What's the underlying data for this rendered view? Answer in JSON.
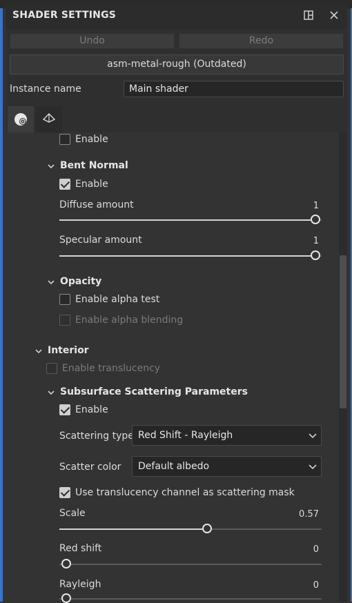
{
  "panel": {
    "title": "SHADER SETTINGS"
  },
  "toolbar": {
    "undo_label": "Undo",
    "redo_label": "Redo"
  },
  "shader": {
    "preset_label": "asm-metal-rough (Outdated)"
  },
  "instance": {
    "label": "Instance name",
    "value": "Main shader"
  },
  "tabs": [
    {
      "icon": "material-sphere-icon"
    },
    {
      "icon": "geometry-icon"
    }
  ],
  "sections": {
    "top_enable": {
      "label": "Enable",
      "checked": false
    },
    "bent_normal": {
      "title": "Bent Normal",
      "enable_label": "Enable",
      "diffuse": {
        "label": "Diffuse amount",
        "value": "1",
        "fraction": 1.0
      },
      "specular": {
        "label": "Specular amount",
        "value": "1",
        "fraction": 1.0
      }
    },
    "opacity": {
      "title": "Opacity",
      "alpha_test_label": "Enable alpha test",
      "alpha_blending_label": "Enable alpha blending"
    },
    "interior": {
      "title": "Interior",
      "translucency_label": "Enable translucency"
    },
    "sss": {
      "title": "Subsurface Scattering Parameters",
      "enable_label": "Enable",
      "scattering_type": {
        "label": "Scattering type",
        "value": "Red Shift - Rayleigh"
      },
      "scatter_color": {
        "label": "Scatter color",
        "value": "Default albedo"
      },
      "mask_label": "Use translucency channel as scattering mask",
      "scale": {
        "label": "Scale",
        "value": "0.57",
        "fraction": 0.57
      },
      "red_shift": {
        "label": "Red shift",
        "value": "0",
        "fraction": 0.0
      },
      "rayleigh": {
        "label": "Rayleigh",
        "value": "0",
        "fraction": 0.0
      }
    }
  },
  "colors": {
    "accent": "#3a74c8",
    "panel_bg": "#333333"
  }
}
